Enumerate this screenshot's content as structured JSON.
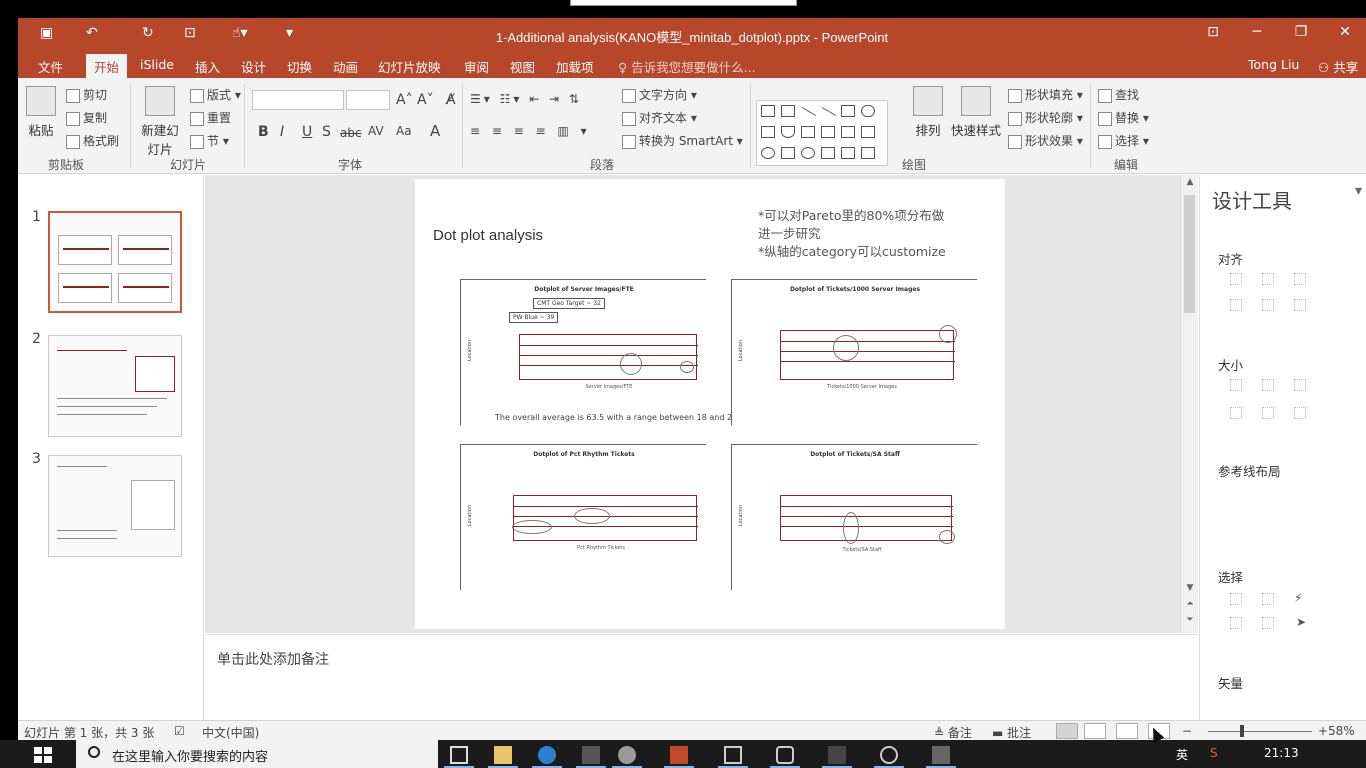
{
  "window": {
    "title": "1-Additional analysis(KANO模型_minitab_dotplot).pptx - PowerPoint",
    "user": "Tong Liu",
    "share": "共享"
  },
  "tabs": [
    {
      "label": "文件"
    },
    {
      "label": "开始"
    },
    {
      "label": "iSlide"
    },
    {
      "label": "插入"
    },
    {
      "label": "设计"
    },
    {
      "label": "切换"
    },
    {
      "label": "动画"
    },
    {
      "label": "幻灯片放映"
    },
    {
      "label": "审阅"
    },
    {
      "label": "视图"
    },
    {
      "label": "加载项"
    }
  ],
  "tell_me": "告诉我您想要做什么...",
  "ribbon": {
    "clipboard": {
      "paste": "粘贴",
      "cut": "剪切",
      "copy": "复制",
      "format_painter": "格式刷",
      "group": "剪贴板"
    },
    "slides": {
      "new_slide": "新建幻灯片",
      "layout": "版式",
      "reset": "重置",
      "section": "节",
      "group": "幻灯片"
    },
    "font": {
      "group": "字体",
      "bold": "B",
      "italic": "I",
      "underline": "U",
      "shadow": "S",
      "strike": "abc",
      "spacing": "AV",
      "case": "Aa",
      "color": "A"
    },
    "paragraph": {
      "text_direction": "文字方向",
      "align_text": "对齐文本",
      "smartart": "转换为 SmartArt",
      "group": "段落"
    },
    "drawing": {
      "arrange": "排列",
      "quick_styles": "快速样式",
      "fill": "形状填充",
      "outline": "形状轮廓",
      "effects": "形状效果",
      "group": "绘图"
    },
    "editing": {
      "find": "查找",
      "replace": "替换",
      "select": "选择",
      "group": "编辑"
    }
  },
  "slide_thumbnails": [
    {
      "number": "1"
    },
    {
      "number": "2"
    },
    {
      "number": "3"
    }
  ],
  "slide": {
    "title": "Dot plot analysis",
    "notes": [
      "*可以对Pareto里的80%项分布做",
      "进一步研究",
      "*纵轴的category可以customize"
    ],
    "caption": "The overall average is 63.5 with a range between 18 and 205"
  },
  "chart_data": [
    {
      "type": "scatter",
      "title": "Dotplot of Server Images/FTE",
      "xlabel": "Server Images/FTE",
      "ylabel": "Location",
      "x_ticks": [
        "25",
        "50",
        "75",
        "100",
        "125",
        "150",
        "175",
        "200"
      ],
      "annotations": [
        "CMT Geo Target ~ 32",
        "PW Blue ~ 39"
      ]
    },
    {
      "type": "scatter",
      "title": "Dotplot of Tickets/1000 Server Images",
      "xlabel": "Tickets/1000 Server Images",
      "ylabel": "Location",
      "x_ticks": [
        "0",
        "250",
        "500",
        "750",
        "1000",
        "1250",
        "1500",
        "1750"
      ]
    },
    {
      "type": "scatter",
      "title": "Dotplot of Pct Rhythm Tickets",
      "xlabel": "Pct Rhythm Tickets",
      "ylabel": "Location"
    },
    {
      "type": "scatter",
      "title": "Dotplot of Tickets/SA Staff",
      "xlabel": "Tickets/SA Staff",
      "ylabel": "Location"
    }
  ],
  "notes_placeholder": "单击此处添加备注",
  "design_pane": {
    "title": "设计工具",
    "sections": [
      "对齐",
      "大小",
      "参考线布局",
      "选择",
      "矢量"
    ]
  },
  "status": {
    "slide_info": "幻灯片 第 1 张，共 3 张",
    "language": "中文(中国)",
    "notes": "备注",
    "comments": "批注",
    "zoom": "58%"
  },
  "taskbar": {
    "search_placeholder": "在这里输入你要搜索的内容",
    "ime": "英",
    "time": "21:13"
  }
}
